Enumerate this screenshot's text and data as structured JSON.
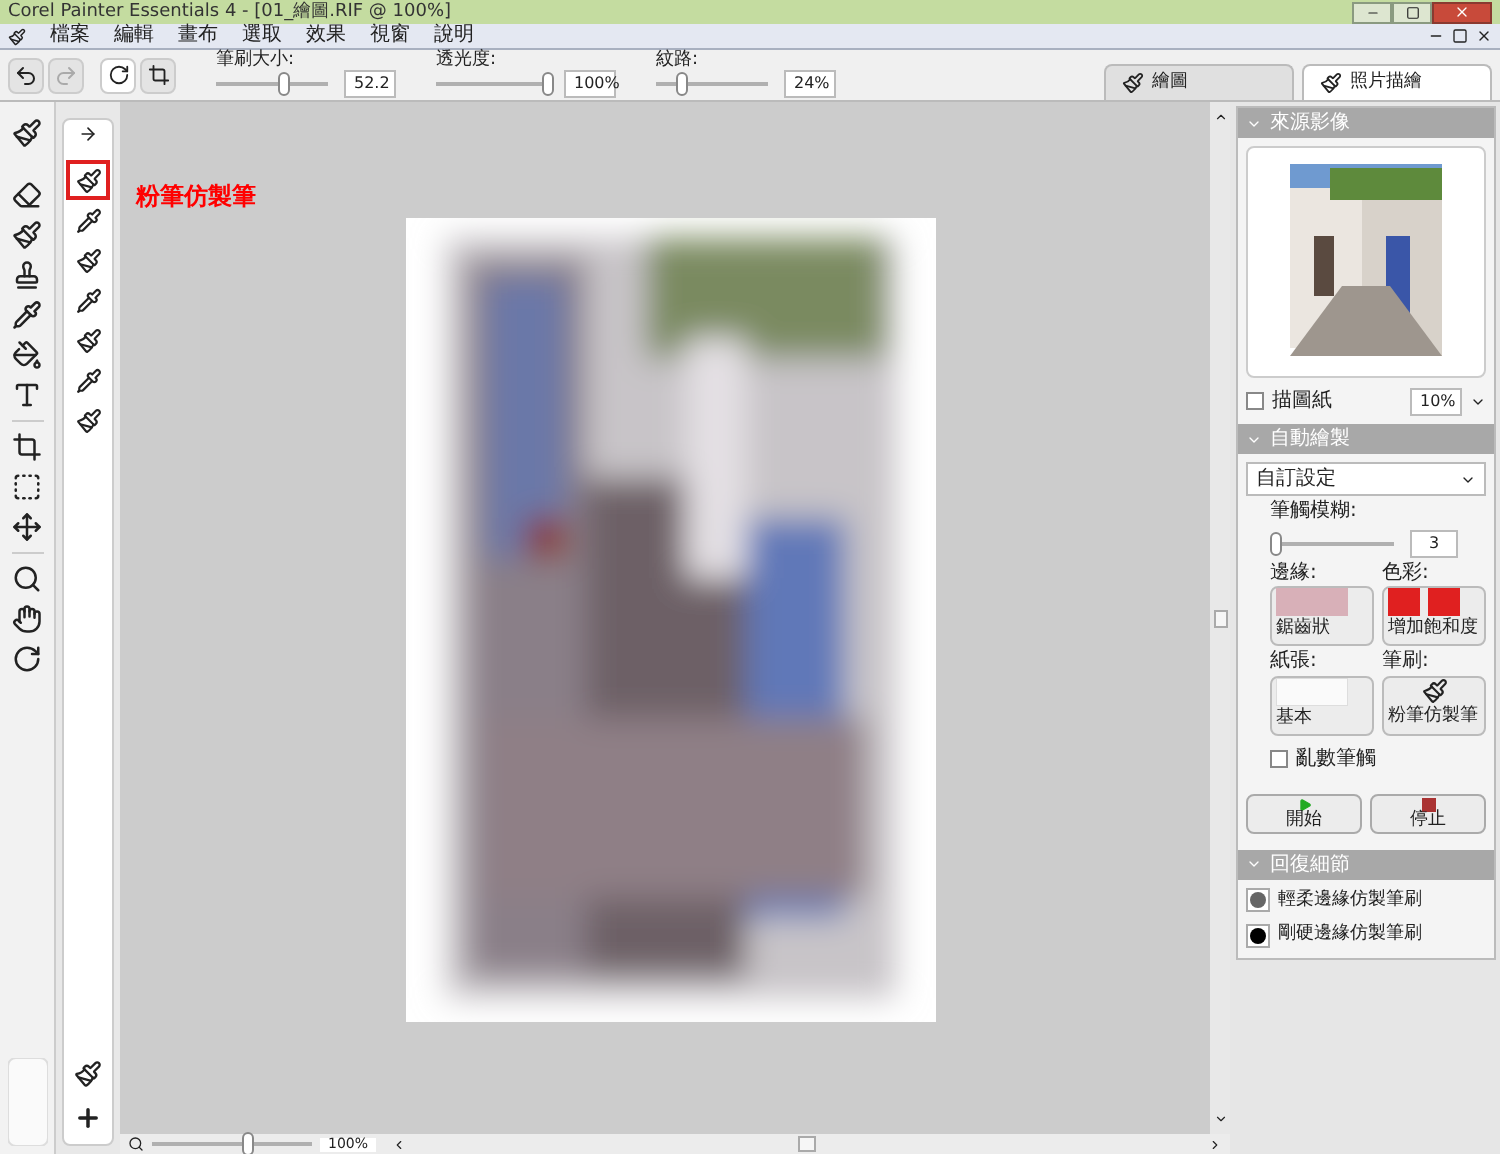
{
  "window": {
    "title": "Corel Painter Essentials 4 - [01_繪圖.RIF @ 100%]"
  },
  "menu": [
    "檔案",
    "編輯",
    "畫布",
    "選取",
    "效果",
    "視窗",
    "說明"
  ],
  "toolbar": {
    "sliders": [
      {
        "label": "筆刷大小:",
        "value": "52.2",
        "level": 0.6
      },
      {
        "label": "透光度:",
        "value": "100%",
        "level": 1
      },
      {
        "label": "紋路:",
        "value": "24%",
        "level": 0.23
      }
    ]
  },
  "tabs": [
    {
      "label": "繪圖",
      "selected": false
    },
    {
      "label": "照片描繪",
      "selected": true
    }
  ],
  "brush_variants": [
    {
      "selected": true
    },
    {
      "selected": false
    },
    {
      "selected": false
    },
    {
      "selected": false
    },
    {
      "selected": false
    },
    {
      "selected": false
    },
    {
      "selected": false
    }
  ],
  "callout": "粉筆仿製筆",
  "source_panel": {
    "title": "來源影像",
    "tracing": {
      "label": "描圖紙",
      "checked": false
    },
    "zoom": "10%"
  },
  "auto_panel": {
    "title": "自動繪製",
    "preset": "自訂設定",
    "blur": {
      "label": "筆觸模糊:",
      "value": "3",
      "level": 0.05
    },
    "options": [
      {
        "label": "邊緣:",
        "value": "鋸齒狀",
        "kind": "edge"
      },
      {
        "label": "色彩:",
        "value": "增加飽和度",
        "kind": "color"
      },
      {
        "label": "紙張:",
        "value": "基本",
        "kind": "paper"
      },
      {
        "label": "筆刷:",
        "value": "粉筆仿製筆",
        "kind": "brush"
      }
    ],
    "random": {
      "label": "亂數筆觸",
      "checked": false
    },
    "start": "開始",
    "stop": "停止"
  },
  "restore_panel": {
    "title": "回復細節",
    "items": [
      "輕柔邊緣仿製筆刷",
      "剛硬邊緣仿製筆刷"
    ]
  },
  "status_bar": {
    "zoom": "100%",
    "zoom_slider": {
      "level": 0.6
    }
  }
}
